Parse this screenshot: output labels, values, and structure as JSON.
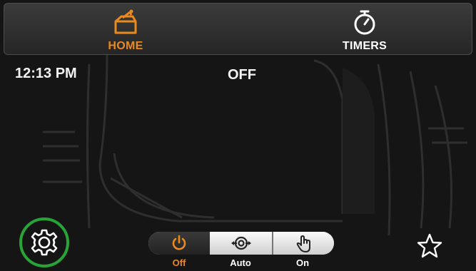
{
  "nav": {
    "tabs": [
      {
        "label": "HOME",
        "icon": "home-unit-icon",
        "active": true
      },
      {
        "label": "TIMERS",
        "icon": "stopwatch-icon",
        "active": false
      }
    ]
  },
  "status": {
    "time": "12:13 PM",
    "state": "OFF"
  },
  "modes": {
    "selected": "Off",
    "items": [
      {
        "label": "Off",
        "icon": "power-icon"
      },
      {
        "label": "Auto",
        "icon": "auto-cycle-icon"
      },
      {
        "label": "On",
        "icon": "hand-touch-icon"
      }
    ]
  },
  "icons": {
    "settings": "gear-icon",
    "favorite": "star-icon"
  },
  "colors": {
    "accent": "#e98a1f",
    "settings_ring": "#27a437",
    "background": "#151515"
  }
}
